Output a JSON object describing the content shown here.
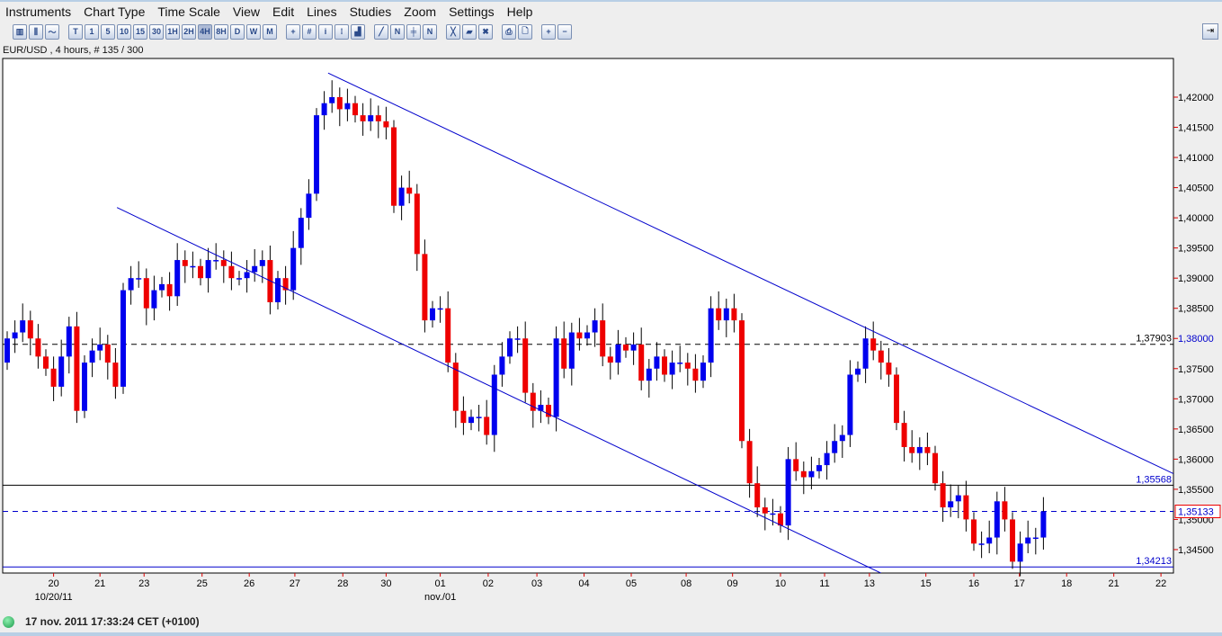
{
  "menu": [
    "Instruments",
    "Chart Type",
    "Time Scale",
    "View",
    "Edit",
    "Lines",
    "Studies",
    "Zoom",
    "Settings",
    "Help"
  ],
  "toolbar": {
    "chart_types": [
      "bar-chart-icon",
      "candle-chart-icon",
      "line-chart-icon"
    ],
    "timescales": [
      "T",
      "1",
      "5",
      "10",
      "15",
      "30",
      "1H",
      "2H",
      "4H",
      "8H",
      "D",
      "W",
      "M"
    ],
    "active_timescale": "4H",
    "tools": [
      "crosshair-icon",
      "grid-icon",
      "info-icon",
      "volume-icon",
      "indicator-icon",
      "trendline-icon",
      "channel-icon",
      "parallel-icon",
      "fib-icon",
      "delete-line-icon",
      "eraser-icon",
      "delete-all-icon",
      "print-icon",
      "print-preview-icon",
      "zoom-in-icon",
      "zoom-out-icon"
    ]
  },
  "chart_title": "EUR/USD , 4 hours, # 135 / 300",
  "status": {
    "time": "17 nov. 2011 17:33:24  CET (+0100)",
    "connected_color": "#22aa55"
  },
  "chart_data": {
    "type": "candlestick",
    "symbol": "EUR/USD",
    "timeframe": "4 hours",
    "ylim": [
      1.3405,
      1.4255
    ],
    "yticks": [
      "1,42000",
      "1,41500",
      "1,41000",
      "1,40500",
      "1,40000",
      "1,39500",
      "1,39000",
      "1,38500",
      "1,38000",
      "1,37500",
      "1,37000",
      "1,36500",
      "1,36000",
      "1,35500",
      "1,35000",
      "1,34500"
    ],
    "ytick_values": [
      1.42,
      1.415,
      1.41,
      1.405,
      1.4,
      1.395,
      1.39,
      1.385,
      1.38,
      1.375,
      1.37,
      1.365,
      1.36,
      1.355,
      1.35,
      1.345
    ],
    "open_first": 1.376,
    "closes": [
      1.38,
      1.381,
      1.383,
      1.38,
      1.377,
      1.375,
      1.372,
      1.377,
      1.382,
      1.368,
      1.376,
      1.378,
      1.379,
      1.376,
      1.372,
      1.388,
      1.39,
      1.39,
      1.385,
      1.388,
      1.389,
      1.387,
      1.393,
      1.392,
      1.392,
      1.39,
      1.393,
      1.393,
      1.392,
      1.39,
      1.39,
      1.391,
      1.392,
      1.393,
      1.386,
      1.39,
      1.388,
      1.395,
      1.4,
      1.404,
      1.417,
      1.419,
      1.42,
      1.418,
      1.419,
      1.417,
      1.416,
      1.417,
      1.416,
      1.415,
      1.402,
      1.405,
      1.404,
      1.394,
      1.383,
      1.385,
      1.385,
      1.376,
      1.368,
      1.366,
      1.367,
      1.367,
      1.364,
      1.374,
      1.377,
      1.38,
      1.38,
      1.371,
      1.368,
      1.369,
      1.367,
      1.38,
      1.375,
      1.381,
      1.38,
      1.381,
      1.383,
      1.377,
      1.376,
      1.379,
      1.378,
      1.379,
      1.373,
      1.375,
      1.377,
      1.374,
      1.376,
      1.376,
      1.375,
      1.373,
      1.376,
      1.385,
      1.383,
      1.385,
      1.383,
      1.363,
      1.356,
      1.352,
      1.351,
      1.351,
      1.349,
      1.36,
      1.358,
      1.357,
      1.358,
      1.359,
      1.361,
      1.363,
      1.364,
      1.374,
      1.375,
      1.38,
      1.378,
      1.376,
      1.374,
      1.366,
      1.362,
      1.361,
      1.362,
      1.361,
      1.356,
      1.352,
      1.353,
      1.354,
      1.35,
      1.346,
      1.346,
      1.347,
      1.353,
      1.35,
      1.343,
      1.346,
      1.347,
      1.347,
      1.3513
    ],
    "xticks": [
      {
        "label": "20",
        "i": 6
      },
      {
        "label": "21",
        "i": 12
      },
      {
        "label": "23",
        "i": 17.7
      },
      {
        "label": "25",
        "i": 25.2
      },
      {
        "label": "26",
        "i": 31.3
      },
      {
        "label": "27",
        "i": 37.2
      },
      {
        "label": "28",
        "i": 43.4
      },
      {
        "label": "30",
        "i": 49
      },
      {
        "label": "01",
        "i": 56
      },
      {
        "label": "02",
        "i": 62.2
      },
      {
        "label": "03",
        "i": 68.5
      },
      {
        "label": "04",
        "i": 74.6
      },
      {
        "label": "05",
        "i": 80.7
      },
      {
        "label": "08",
        "i": 87.8
      },
      {
        "label": "09",
        "i": 93.8
      },
      {
        "label": "10",
        "i": 100
      },
      {
        "label": "11",
        "i": 105.7
      },
      {
        "label": "13",
        "i": 111.5
      },
      {
        "label": "15",
        "i": 118.8
      },
      {
        "label": "16",
        "i": 125
      },
      {
        "label": "17",
        "i": 130.9
      },
      {
        "label": "18",
        "i": 137
      },
      {
        "label": "21",
        "i": 143.1
      },
      {
        "label": "22",
        "i": 149.2
      }
    ],
    "xsublabels": [
      {
        "label": "10/20/11",
        "i": 6
      },
      {
        "label": "nov./01",
        "i": 56
      }
    ],
    "trendlines": [
      {
        "i1": 41.5,
        "p1": 1.424,
        "i2": 150.8,
        "p2": 1.3576,
        "color": "#0000cc"
      },
      {
        "i1": 14.2,
        "p1": 1.4017,
        "i2": 113,
        "p2": 1.3411,
        "color": "#0000cc"
      }
    ],
    "hlines": [
      {
        "value": 1.37903,
        "label": "1,37903",
        "style": "dashed",
        "color": "#000000"
      },
      {
        "value": 1.35568,
        "label": "1,35568",
        "style": "solid",
        "color": "#000000",
        "label_color": "#0000cc"
      },
      {
        "value": 1.34213,
        "label": "1,34213",
        "style": "solid",
        "color": "#0000cc"
      },
      {
        "value": 1.35133,
        "label": "1,35133",
        "style": "dashed",
        "color": "#0000cc",
        "current": true
      }
    ],
    "highlight_tick": "1,38000",
    "up_color": "#0000ee",
    "down_color": "#ee0000"
  }
}
